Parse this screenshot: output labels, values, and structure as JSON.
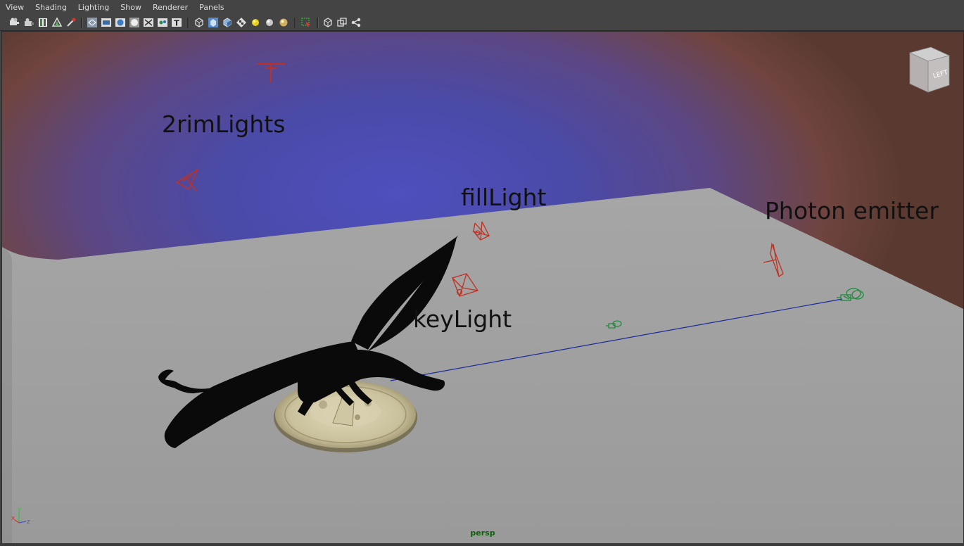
{
  "menu": [
    "View",
    "Shading",
    "Lighting",
    "Show",
    "Renderer",
    "Panels"
  ],
  "toolbar_icons": [
    "select-camera-icon",
    "camera-attributes-icon",
    "bookmarks-icon",
    "image-plane-icon",
    "grease-pencil-icon",
    "wireframe-icon",
    "smooth-shade-icon",
    "smooth-shade-all-icon",
    "default-material-icon",
    "xray-icon",
    "xray-joints-icon",
    "textured-icon",
    "text-t-icon",
    "isolate-select-icon",
    "two-sided-lighting-icon",
    "backface-icon",
    "textures-checker-icon",
    "use-all-lights-icon",
    "shadows-icon",
    "ambient-occlusion-icon",
    "selection-highlight-icon",
    "show-polygons-icon",
    "show-surfaces-icon",
    "show-nodes-icon"
  ],
  "viewport": {
    "labels": {
      "rim_lights": "2rimLights",
      "fill_light": "fillLight",
      "key_light": "keyLight",
      "photon_emitter": "Photon emitter"
    },
    "viewcube_face": "LEFT",
    "camera_name": "persp",
    "axis": {
      "x": "x",
      "y": "y",
      "z": "z"
    }
  },
  "colors": {
    "light_gizmo": "#c03020",
    "camera_gizmo": "#1b8a3a",
    "ground_plane": "#a3a3a3"
  }
}
